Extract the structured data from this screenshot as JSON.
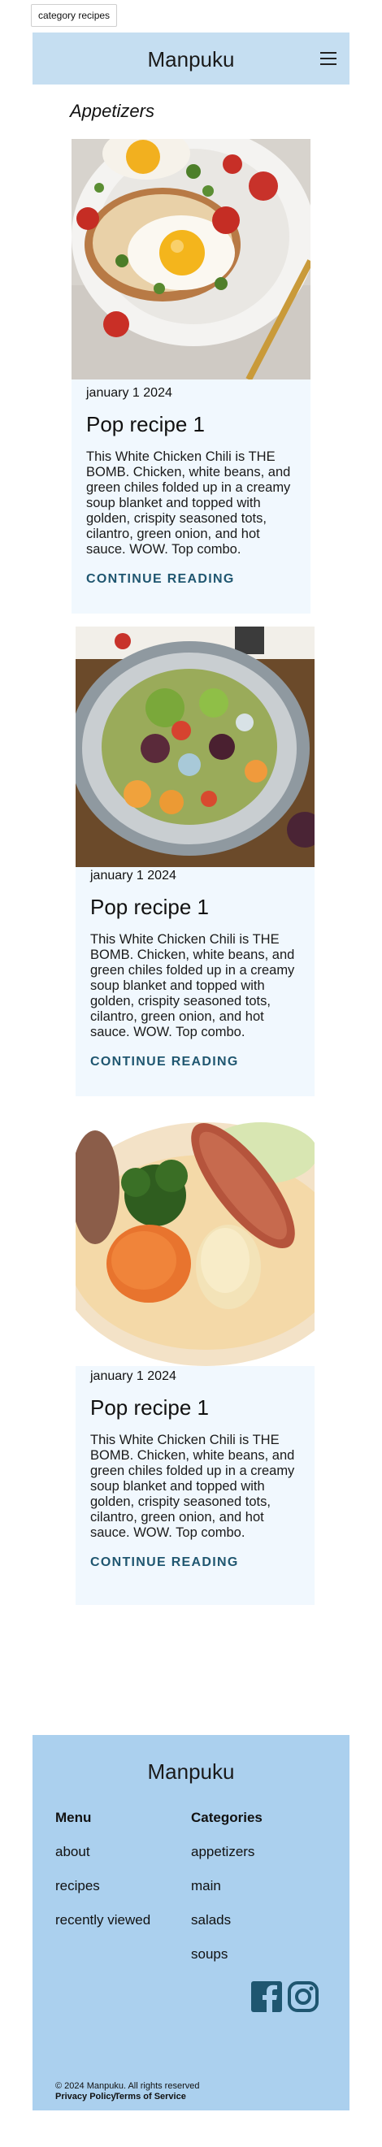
{
  "tab_label": "category recipes",
  "header": {
    "brand": "Manpuku"
  },
  "section_title": "Appetizers",
  "cards": [
    {
      "date": "january 1 2024",
      "title": "Pop recipe 1",
      "excerpt": "This White Chicken Chili is THE BOMB. Chicken, white beans, and green chiles folded up in a creamy soup blanket and topped with golden, crispity seasoned tots, cilantro, green onion, and hot sauce. WOW. Top combo.",
      "cta": "CONTINUE READING"
    },
    {
      "date": "january 1 2024",
      "title": "Pop recipe 1",
      "excerpt": "This White Chicken Chili is THE BOMB. Chicken, white beans, and green chiles folded up in a creamy soup blanket and topped with golden, crispity seasoned tots, cilantro, green onion, and hot sauce. WOW. Top combo.",
      "cta": "CONTINUE READING"
    },
    {
      "date": "january 1 2024",
      "title": "Pop recipe 1",
      "excerpt": "This White Chicken Chili is THE BOMB. Chicken, white beans, and green chiles folded up in a creamy soup blanket and topped with golden, crispity seasoned tots, cilantro, green onion, and hot sauce. WOW. Top combo.",
      "cta": "CONTINUE READING"
    }
  ],
  "footer": {
    "brand": "Manpuku",
    "menu_heading": "Menu",
    "menu_links": [
      "about",
      "recipes",
      "recently viewed"
    ],
    "categories_heading": "Categories",
    "category_links": [
      "appetizers",
      "main",
      "salads",
      "soups"
    ],
    "social_icons": [
      "facebook-icon",
      "instagram-icon"
    ],
    "copyright": "© 2024 Manpuku. All rights reserved",
    "privacy": "Privacy Policy",
    "terms": "Terms of Service"
  },
  "colors": {
    "header_bg": "#c5def1",
    "card_bg": "#f1f8fe",
    "footer_bg": "#abd0ee",
    "accent": "#1f5670"
  }
}
